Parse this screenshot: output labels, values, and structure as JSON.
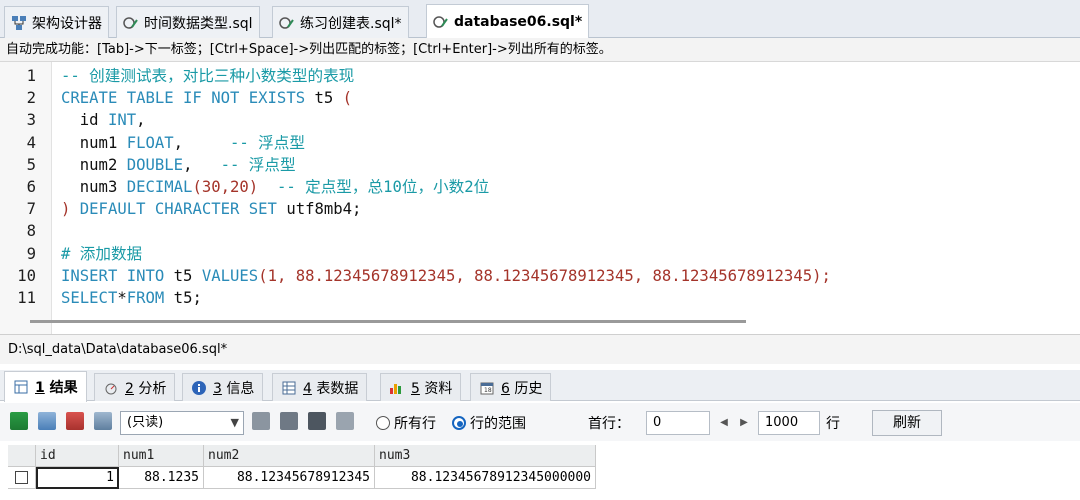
{
  "file_tabs": [
    {
      "label": "架构设计器",
      "icon": "schema-designer-icon"
    },
    {
      "label": "时间数据类型.sql",
      "icon": "sql-file-icon"
    },
    {
      "label": "练习创建表.sql*",
      "icon": "sql-file-icon"
    },
    {
      "label": "database06.sql*",
      "icon": "sql-file-icon",
      "active": true
    }
  ],
  "hint": "自动完成功能：[Tab]->下一标签；[Ctrl+Space]->列出匹配的标签；[Ctrl+Enter]->列出所有的标签。",
  "editor": {
    "line_numbers": [
      "1",
      "2",
      "3",
      "4",
      "5",
      "6",
      "7",
      "8",
      "9",
      "10",
      "11"
    ],
    "lines": [
      [
        {
          "t": "-- 创建测试表，对比三种小数类型的表现",
          "c": "cm"
        }
      ],
      [
        {
          "t": "CREATE TABLE IF NOT EXISTS",
          "c": "kw"
        },
        {
          "t": " t5 ",
          "c": "plain"
        },
        {
          "t": "(",
          "c": "num"
        }
      ],
      [
        {
          "t": "  id ",
          "c": "plain"
        },
        {
          "t": "INT",
          "c": "kw"
        },
        {
          "t": ",",
          "c": "plain"
        }
      ],
      [
        {
          "t": "  num1 ",
          "c": "plain"
        },
        {
          "t": "FLOAT",
          "c": "kw"
        },
        {
          "t": ",     ",
          "c": "plain"
        },
        {
          "t": "-- 浮点型",
          "c": "cm"
        }
      ],
      [
        {
          "t": "  num2 ",
          "c": "plain"
        },
        {
          "t": "DOUBLE",
          "c": "kw"
        },
        {
          "t": ",   ",
          "c": "plain"
        },
        {
          "t": "-- 浮点型",
          "c": "cm"
        }
      ],
      [
        {
          "t": "  num3 ",
          "c": "plain"
        },
        {
          "t": "DECIMAL",
          "c": "kw"
        },
        {
          "t": "(30,20)",
          "c": "num"
        },
        {
          "t": "  ",
          "c": "plain"
        },
        {
          "t": "-- 定点型，总10位，小数2位",
          "c": "cm"
        }
      ],
      [
        {
          "t": ")",
          "c": "num"
        },
        {
          "t": " ",
          "c": "plain"
        },
        {
          "t": "DEFAULT CHARACTER SET",
          "c": "kw"
        },
        {
          "t": " utf8mb4;",
          "c": "plain"
        }
      ],
      [],
      [
        {
          "t": "# 添加数据",
          "c": "cm"
        }
      ],
      [
        {
          "t": "INSERT INTO",
          "c": "kw"
        },
        {
          "t": " t5 ",
          "c": "plain"
        },
        {
          "t": "VALUES",
          "c": "kw"
        },
        {
          "t": "(1, 88.12345678912345, 88.12345678912345, 88.12345678912345);",
          "c": "num"
        }
      ],
      [
        {
          "t": "SELECT",
          "c": "kw"
        },
        {
          "t": "*",
          "c": "plain"
        },
        {
          "t": "FROM",
          "c": "kw"
        },
        {
          "t": " t5;",
          "c": "plain"
        }
      ]
    ]
  },
  "path": "D:\\sql_data\\Data\\database06.sql*",
  "result_tabs": [
    {
      "num": "1",
      "label": "结果",
      "icon": "result-icon",
      "active": true
    },
    {
      "num": "2",
      "label": "分析",
      "icon": "profile-icon"
    },
    {
      "num": "3",
      "label": "信息",
      "icon": "info-icon"
    },
    {
      "num": "4",
      "label": "表数据",
      "icon": "table-data-icon"
    },
    {
      "num": "5",
      "label": "资料",
      "icon": "info-chart-icon"
    },
    {
      "num": "6",
      "label": "历史",
      "icon": "history-icon"
    }
  ],
  "toolbar": {
    "mode_select": "(只读)",
    "radio_all": "所有行",
    "radio_range": "行的范围",
    "first_row_label": "首行：",
    "first_row_value": "0",
    "rows_value": "1000",
    "rows_label": "行",
    "refresh": "刷新"
  },
  "grid": {
    "columns": [
      "id",
      "num1",
      "num2",
      "num3"
    ],
    "rows": [
      [
        "1",
        "88.1235",
        "88.12345678912345",
        "88.12345678912345000000"
      ]
    ]
  },
  "colors": {
    "keyword": "#2a8bb8",
    "comment": "#1a9aa6",
    "number": "#a4342a"
  }
}
